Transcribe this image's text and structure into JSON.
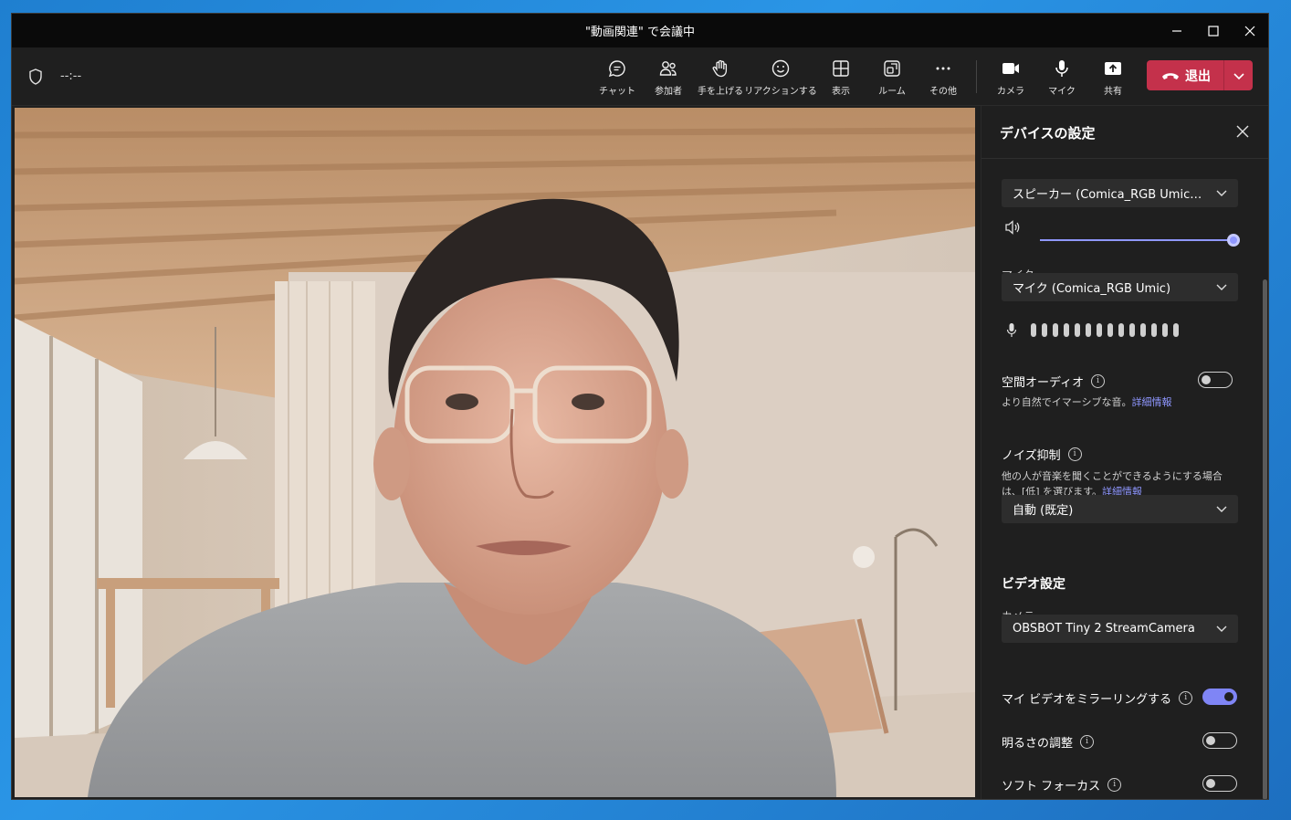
{
  "window": {
    "title": "\"動画関連\" で会議中",
    "timer": "--:--"
  },
  "toolbar": {
    "items": [
      {
        "label": "チャット",
        "icon": "chat-icon"
      },
      {
        "label": "参加者",
        "icon": "people-icon"
      },
      {
        "label": "手を上げる",
        "icon": "raise-hand-icon"
      },
      {
        "label": "リアクションする",
        "icon": "smile-icon"
      },
      {
        "label": "表示",
        "icon": "grid-icon"
      },
      {
        "label": "ルーム",
        "icon": "rooms-icon"
      },
      {
        "label": "その他",
        "icon": "more-icon"
      },
      {
        "label": "カメラ",
        "icon": "camera-icon"
      },
      {
        "label": "マイク",
        "icon": "microphone-icon"
      },
      {
        "label": "共有",
        "icon": "share-icon"
      }
    ],
    "leave_label": "退出",
    "accent": "#c4314b"
  },
  "panel": {
    "title": "デバイスの設定",
    "speaker_select": "スピーカー (Comica_RGB Umic) (1...",
    "speaker_volume_percent": 100,
    "mic_label": "マイク",
    "mic_select": "マイク (Comica_RGB Umic)",
    "spatial_audio": {
      "name": "空間オーディオ",
      "desc": "より自然でイマーシブな音。",
      "link": "詳細情報",
      "enabled": false
    },
    "noise": {
      "name": "ノイズ抑制",
      "desc": "他の人が音楽を聞くことができるようにする場合は、[低] を選びます。",
      "link": "詳細情報",
      "select": "自動 (既定)"
    },
    "video": {
      "section": "ビデオ設定",
      "camera_label": "カメラ",
      "camera_select": "OBSBOT Tiny 2 StreamCamera",
      "mirror": {
        "name": "マイ ビデオをミラーリングする",
        "enabled": true
      },
      "brightness": {
        "name": "明るさの調整",
        "enabled": false
      },
      "soft_focus": {
        "name": "ソフト フォーカス",
        "enabled": false
      }
    },
    "accent": "#7f85f5"
  }
}
